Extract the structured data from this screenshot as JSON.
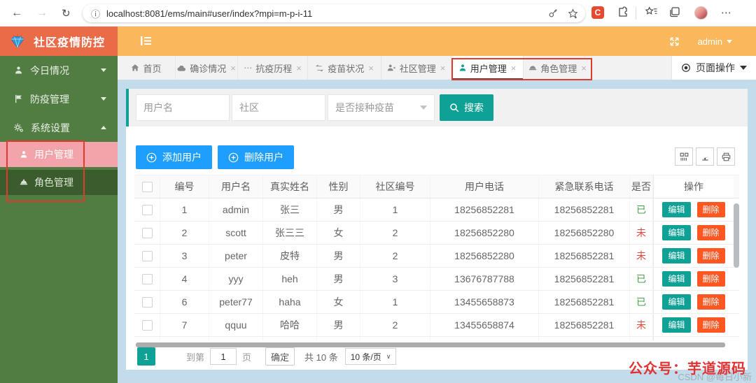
{
  "browser": {
    "url": "localhost:8081/ems/main#user/index?mpi=m-p-i-11",
    "extension_badge": "C"
  },
  "header": {
    "logo_text": "社区疫情防控",
    "username": "admin"
  },
  "sidebar": {
    "items": [
      {
        "label": "今日情况"
      },
      {
        "label": "防疫管理"
      },
      {
        "label": "系统设置"
      }
    ],
    "subitems": [
      {
        "label": "用户管理"
      },
      {
        "label": "角色管理"
      }
    ]
  },
  "tabs": {
    "items": [
      {
        "label": "首页"
      },
      {
        "label": "确诊情况"
      },
      {
        "label": "抗疫历程"
      },
      {
        "label": "疫苗状况"
      },
      {
        "label": "社区管理"
      },
      {
        "label": "用户管理"
      },
      {
        "label": "角色管理"
      }
    ],
    "page_ops_label": "页面操作"
  },
  "filters": {
    "username_placeholder": "用户名",
    "community_placeholder": "社区",
    "vaccine_placeholder": "是否接种疫苗",
    "search_label": "搜索"
  },
  "actions": {
    "add_label": "添加用户",
    "delete_label": "删除用户"
  },
  "table": {
    "headers": [
      "编号",
      "用户名",
      "真实姓名",
      "性别",
      "社区编号",
      "用户电话",
      "紧急联系电话",
      "是否",
      "操作"
    ],
    "rows": [
      {
        "id": "1",
        "username": "admin",
        "realname": "张三",
        "gender": "男",
        "community": "1",
        "phone": "18256852281",
        "emergency": "18256852281",
        "vaccinated": "已",
        "vaccinated_status": "yes"
      },
      {
        "id": "2",
        "username": "scott",
        "realname": "张三三",
        "gender": "女",
        "community": "2",
        "phone": "18256852280",
        "emergency": "18256852280",
        "vaccinated": "未",
        "vaccinated_status": "no"
      },
      {
        "id": "3",
        "username": "peter",
        "realname": "皮特",
        "gender": "男",
        "community": "2",
        "phone": "18256852280",
        "emergency": "18256852281",
        "vaccinated": "未",
        "vaccinated_status": "no"
      },
      {
        "id": "4",
        "username": "yyy",
        "realname": "heh",
        "gender": "男",
        "community": "3",
        "phone": "13676787788",
        "emergency": "18256852281",
        "vaccinated": "已",
        "vaccinated_status": "yes"
      },
      {
        "id": "6",
        "username": "peter77",
        "realname": "haha",
        "gender": "女",
        "community": "1",
        "phone": "13455658873",
        "emergency": "18256852281",
        "vaccinated": "已",
        "vaccinated_status": "yes"
      },
      {
        "id": "7",
        "username": "qquu",
        "realname": "哈哈",
        "gender": "男",
        "community": "2",
        "phone": "13455658874",
        "emergency": "18256852281",
        "vaccinated": "未",
        "vaccinated_status": "no"
      }
    ],
    "partial_row": true,
    "edit_label": "编辑",
    "delete_label": "删除"
  },
  "pagination": {
    "current": "1",
    "goto_prefix": "到第",
    "goto_value": "1",
    "goto_suffix": "页",
    "confirm_label": "确定",
    "total_label": "共 10 条",
    "page_size": "10 条/页"
  },
  "watermarks": {
    "red": "公众号：芋道源码",
    "gray": "CSDN @每日小新"
  },
  "icons": {
    "back": "←",
    "forward": "→",
    "refresh": "↻",
    "info": "ⓘ",
    "more": "⋯",
    "close": "×",
    "ellipsis": "⋯",
    "size_chevron": "∨"
  },
  "colors": {
    "accent_teal": "#0FA195",
    "button_blue": "#1E9FFF",
    "header_orange": "#F9B85C",
    "logo_coral": "#E96B47",
    "sidebar_green": "#517D43",
    "submenu_dark": "#3B5C2D",
    "active_pink": "#F2A4AA",
    "delete_orange": "#FF5722",
    "vaccinated_yes": "#44A248",
    "vaccinated_no": "#E0483C",
    "annotation_red": "#E23B2E"
  }
}
